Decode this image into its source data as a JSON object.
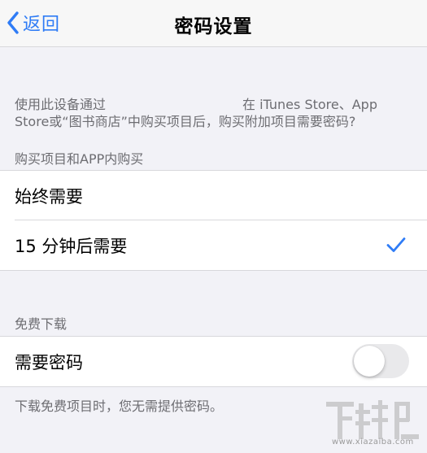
{
  "navbar": {
    "back_label": "返回",
    "title": "密码设置"
  },
  "purchases": {
    "description_part1": "使用此设备通过",
    "description_part2": "在 iTunes Store、App",
    "description_line2": "Store或“图书商店”中购买项目后，购买附加项目需要密码?",
    "header": "购买项目和APP内购买",
    "options": [
      {
        "label": "始终需要",
        "selected": false
      },
      {
        "label": "15 分钟后需要",
        "selected": true
      }
    ]
  },
  "free_downloads": {
    "header": "免费下载",
    "require_password_label": "需要密码",
    "require_password_on": false,
    "footer": "下载免费项目时，您无需提供密码。"
  },
  "watermark": {
    "text": "下载吧",
    "caption": "www.xiazaiba.com"
  },
  "colors": {
    "accent": "#2f7cf6",
    "background": "#f2f2f7",
    "secondary_text": "#6d6d72",
    "toggle_off": "#e9e9eb"
  }
}
